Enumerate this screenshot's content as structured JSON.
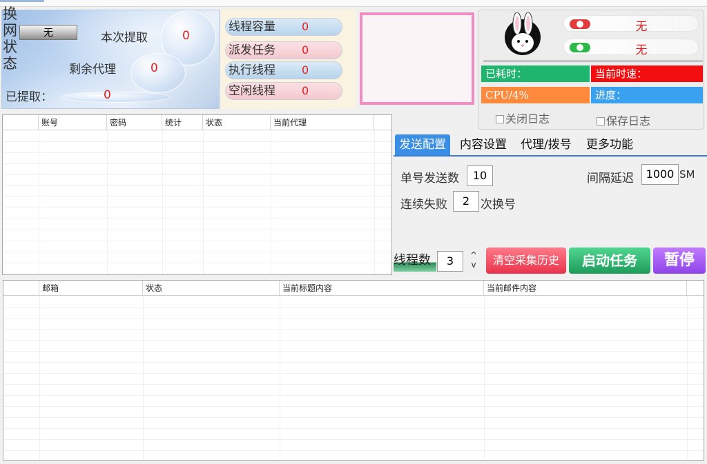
{
  "network": {
    "switch_status_label": "换网状态",
    "switch_button": "无",
    "this_extract_label": "本次提取",
    "this_extract_value": "0",
    "remaining_proxy_label": "剩余代理",
    "remaining_proxy_value": "0",
    "extracted_label": "已提取：",
    "extracted_value": "0"
  },
  "stats": [
    {
      "label": "线程容量",
      "value": "0",
      "style": "blue"
    },
    {
      "label": "派发任务",
      "value": "0",
      "style": "pink"
    },
    {
      "label": "执行线程",
      "value": "0",
      "style": "blue"
    },
    {
      "label": "空闲线程",
      "value": "0",
      "style": "pink"
    }
  ],
  "info": {
    "status1_value": "无",
    "status2_value": "无",
    "elapsed_label": "已耗时：",
    "speed_label": "当前时速：",
    "cpu_label": "CPU/4%",
    "progress_label": "进度：",
    "close_log_label": "关闭日志",
    "save_log_label": "保存日志",
    "colors": {
      "green": "#1fb56f",
      "red": "#f30f0f",
      "orange": "#ff8a3d",
      "blue": "#3aa0f0"
    }
  },
  "accounts_table": {
    "columns": [
      "",
      "账号",
      "密码",
      "统计",
      "状态",
      "当前代理"
    ]
  },
  "tabs": [
    "发送配置",
    "内容设置",
    "代理/拨号",
    "更多功能"
  ],
  "send_config": {
    "per_account_label": "单号发送数",
    "per_account_value": "10",
    "interval_label": "间隔延迟",
    "interval_value": "1000",
    "interval_unit": "SM",
    "fail_label": "连续失败",
    "fail_value": "2",
    "fail_suffix": "次换号"
  },
  "actions": {
    "thread_count_label": "线程数",
    "thread_count_value": "3",
    "spinner_up": "^",
    "spinner_down": "v",
    "clear_history": "清空采集历史",
    "start_task": "启动任务",
    "pause": "暂停"
  },
  "mail_table": {
    "columns": [
      "",
      "邮箱",
      "状态",
      "当前标题内容",
      "当前邮件内容"
    ]
  }
}
